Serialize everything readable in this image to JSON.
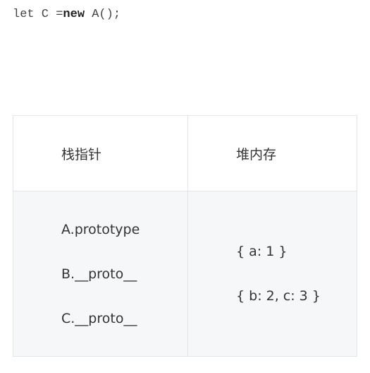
{
  "code": {
    "before_keyword": "let C =",
    "keyword": "new",
    "after_keyword": " A();"
  },
  "table": {
    "headers": [
      "栈指针",
      "堆内存"
    ],
    "stack_items": [
      "A.prototype",
      "B.__proto__",
      "C.__proto__"
    ],
    "heap_items": [
      "{ a: 1 }",
      "{ b: 2, c: 3 }"
    ]
  }
}
